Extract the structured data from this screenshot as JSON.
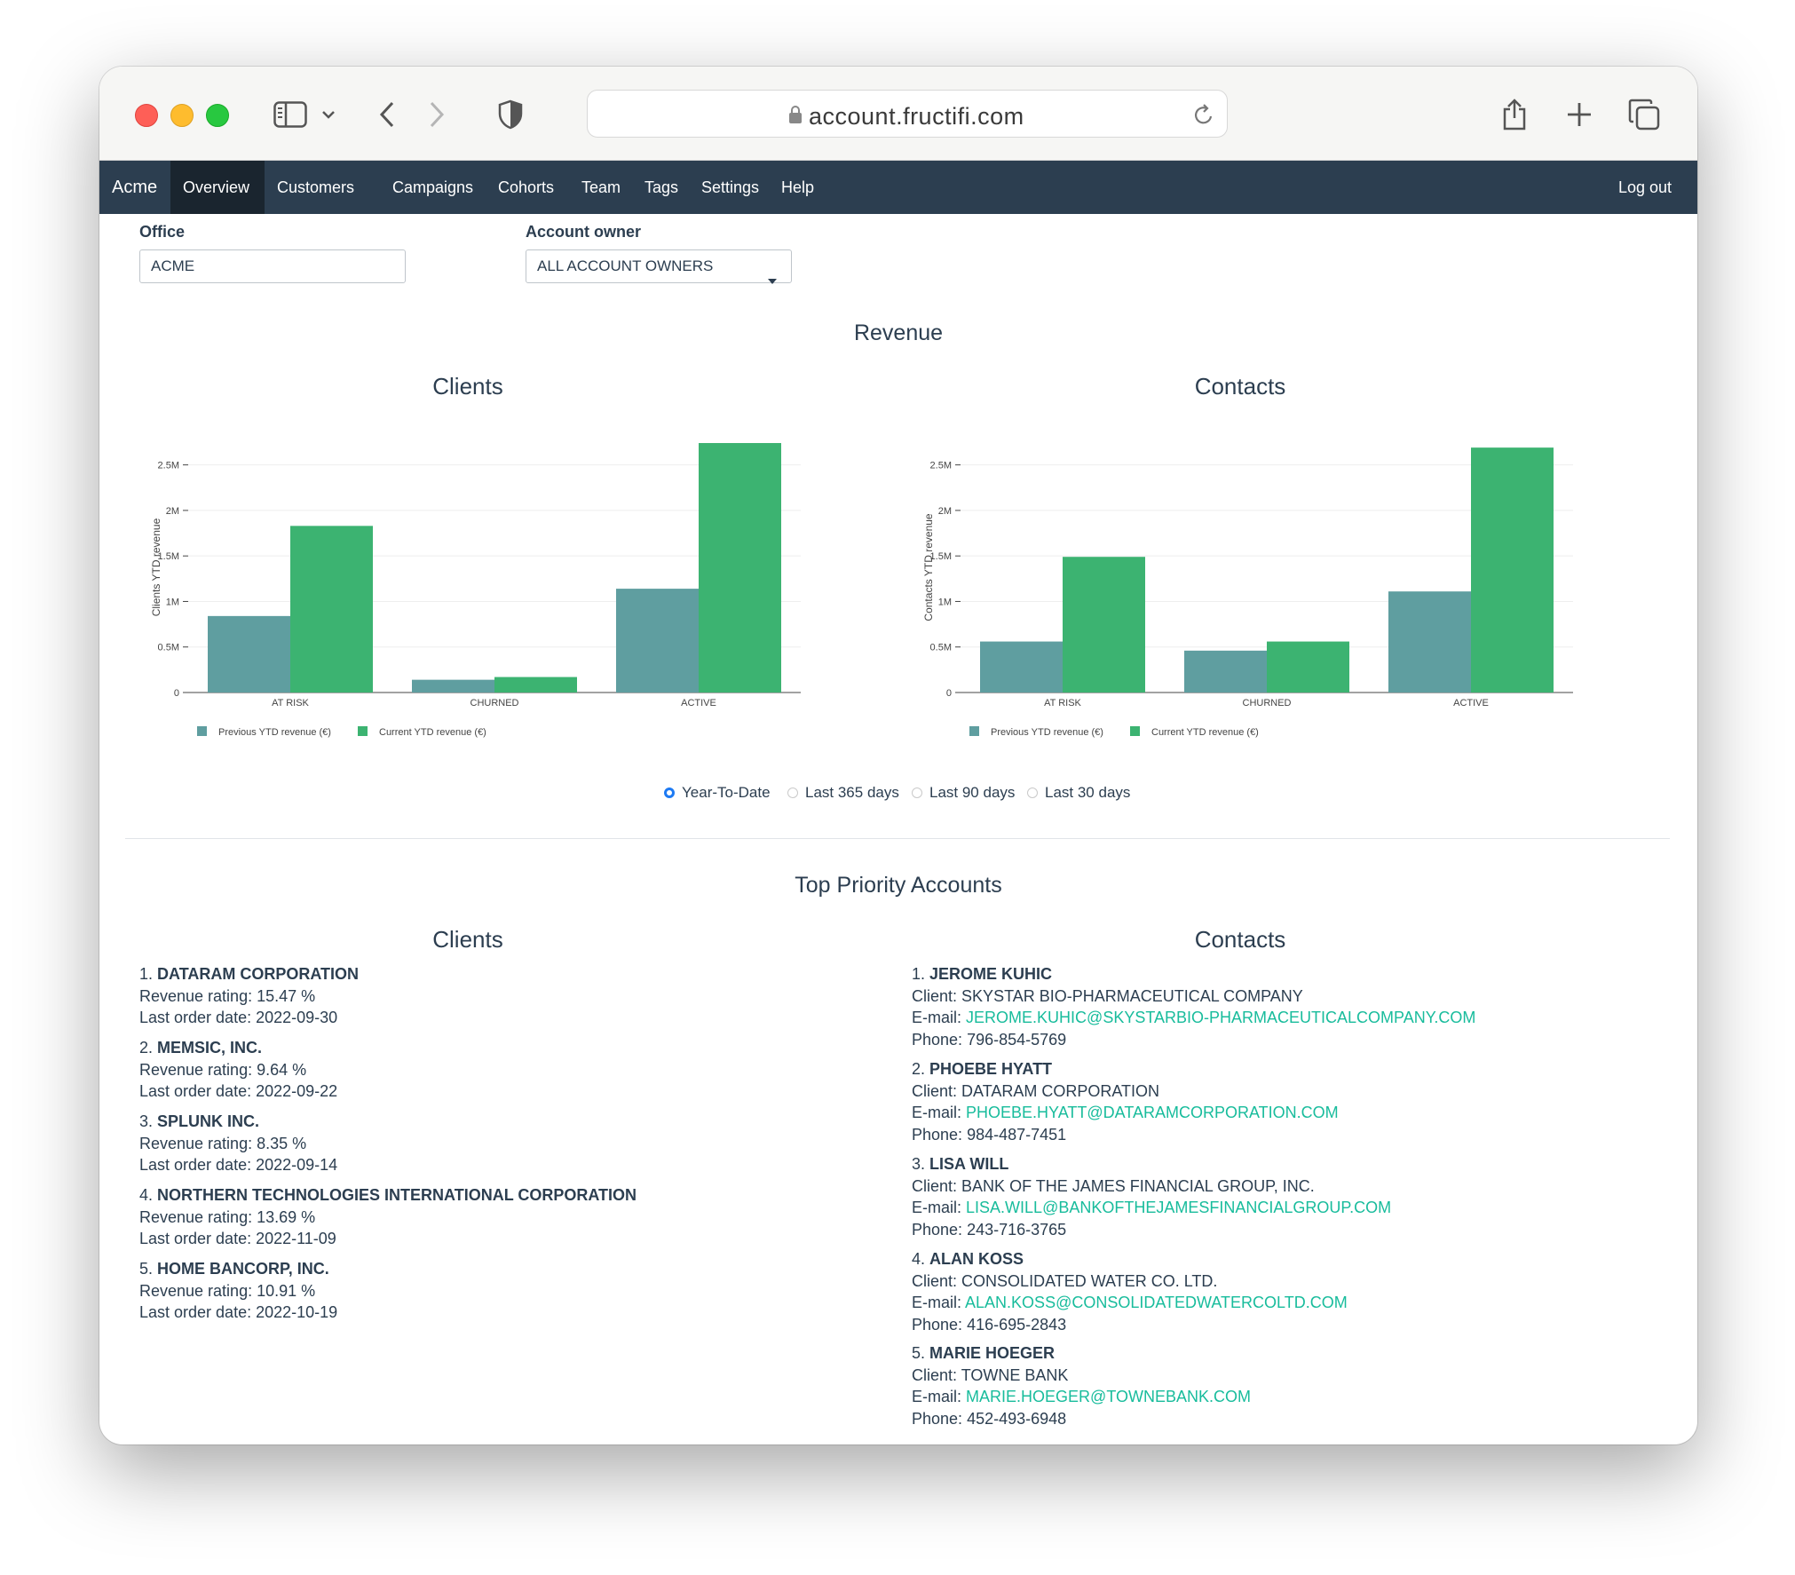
{
  "browser": {
    "url": "account.fructifi.com"
  },
  "nav": {
    "brand": "Acme",
    "items": [
      "Overview",
      "Customers",
      "Campaigns",
      "Cohorts",
      "Team",
      "Tags",
      "Settings",
      "Help"
    ],
    "active": "Overview",
    "logout": "Log out"
  },
  "filters": {
    "office_label": "Office",
    "office_value": "ACME",
    "owner_label": "Account owner",
    "owner_value": "ALL ACCOUNT OWNERS"
  },
  "revenue": {
    "title": "Revenue",
    "periods": [
      "Year-To-Date",
      "Last 365 days",
      "Last 90 days",
      "Last 30 days"
    ],
    "selected_period": "Year-To-Date"
  },
  "chart_data": [
    {
      "type": "bar",
      "title": "Clients",
      "ylabel": "Clients YTD revenue",
      "categories": [
        "AT RISK",
        "CHURNED",
        "ACTIVE"
      ],
      "yticks": [
        "0",
        "0.5M",
        "1M",
        "1.5M",
        "2M",
        "2.5M"
      ],
      "ylim": [
        0,
        2750000
      ],
      "grid": true,
      "legend_position": "bottom-left",
      "series": [
        {
          "name": "Previous YTD revenue (€)",
          "color": "#5f9ea0",
          "values": [
            840000,
            140000,
            1140000
          ]
        },
        {
          "name": "Current YTD revenue (€)",
          "color": "#3cb371",
          "values": [
            1830000,
            170000,
            2740000
          ]
        }
      ]
    },
    {
      "type": "bar",
      "title": "Contacts",
      "ylabel": "Contacts YTD revenue",
      "categories": [
        "AT RISK",
        "CHURNED",
        "ACTIVE"
      ],
      "yticks": [
        "0",
        "0.5M",
        "1M",
        "1.5M",
        "2M",
        "2.5M"
      ],
      "ylim": [
        0,
        2750000
      ],
      "grid": true,
      "legend_position": "bottom-left",
      "series": [
        {
          "name": "Previous YTD revenue (€)",
          "color": "#5f9ea0",
          "values": [
            560000,
            460000,
            1110000
          ]
        },
        {
          "name": "Current YTD revenue (€)",
          "color": "#3cb371",
          "values": [
            1490000,
            560000,
            2690000
          ]
        }
      ]
    }
  ],
  "priority": {
    "title": "Top Priority Accounts",
    "clients_title": "Clients",
    "contacts_title": "Contacts",
    "clients": [
      {
        "index": "1.",
        "name": "DATARAM CORPORATION",
        "rating": "Revenue rating: 15.47 %",
        "last_order": "Last order date: 2022-09-30"
      },
      {
        "index": "2.",
        "name": "MEMSIC, INC.",
        "rating": "Revenue rating: 9.64 %",
        "last_order": "Last order date: 2022-09-22"
      },
      {
        "index": "3.",
        "name": "SPLUNK INC.",
        "rating": "Revenue rating: 8.35 %",
        "last_order": "Last order date: 2022-09-14"
      },
      {
        "index": "4.",
        "name": "NORTHERN TECHNOLOGIES INTERNATIONAL CORPORATION",
        "rating": "Revenue rating: 13.69 %",
        "last_order": "Last order date: 2022-11-09"
      },
      {
        "index": "5.",
        "name": "HOME BANCORP, INC.",
        "rating": "Revenue rating: 10.91 %",
        "last_order": "Last order date: 2022-10-19"
      }
    ],
    "client_prefix": "Client:",
    "email_prefix": "E-mail:",
    "phone_prefix": "Phone:",
    "contacts": [
      {
        "index": "1.",
        "name": "JEROME KUHIC",
        "client": "SKYSTAR BIO-PHARMACEUTICAL COMPANY",
        "email": "JEROME.KUHIC@SKYSTARBIO-PHARMACEUTICALCOMPANY.COM",
        "phone": "796-854-5769"
      },
      {
        "index": "2.",
        "name": "PHOEBE HYATT",
        "client": "DATARAM CORPORATION",
        "email": "PHOEBE.HYATT@DATARAMCORPORATION.COM",
        "phone": "984-487-7451"
      },
      {
        "index": "3.",
        "name": "LISA WILL",
        "client": "BANK OF THE JAMES FINANCIAL GROUP, INC.",
        "email": "LISA.WILL@BANKOFTHEJAMESFINANCIALGROUP.COM",
        "phone": "243-716-3765"
      },
      {
        "index": "4.",
        "name": "ALAN KOSS",
        "client": "CONSOLIDATED WATER CO. LTD.",
        "email": "ALAN.KOSS@CONSOLIDATEDWATERCOLTD.COM",
        "phone": "416-695-2843"
      },
      {
        "index": "5.",
        "name": "MARIE HOEGER",
        "client": "TOWNE BANK",
        "email": "MARIE.HOEGER@TOWNEBANK.COM",
        "phone": "452-493-6948"
      }
    ]
  },
  "colors": {
    "navbar": "#2c3e50",
    "link": "#18bc9c",
    "previous_bar": "#5f9ea0",
    "current_bar": "#3cb371"
  },
  "icons": [
    "sidebar-icon",
    "chevron-down-icon",
    "back-icon",
    "forward-icon",
    "shield-icon",
    "lock-icon",
    "reload-icon",
    "share-icon",
    "new-tab-icon",
    "tabs-icon"
  ]
}
